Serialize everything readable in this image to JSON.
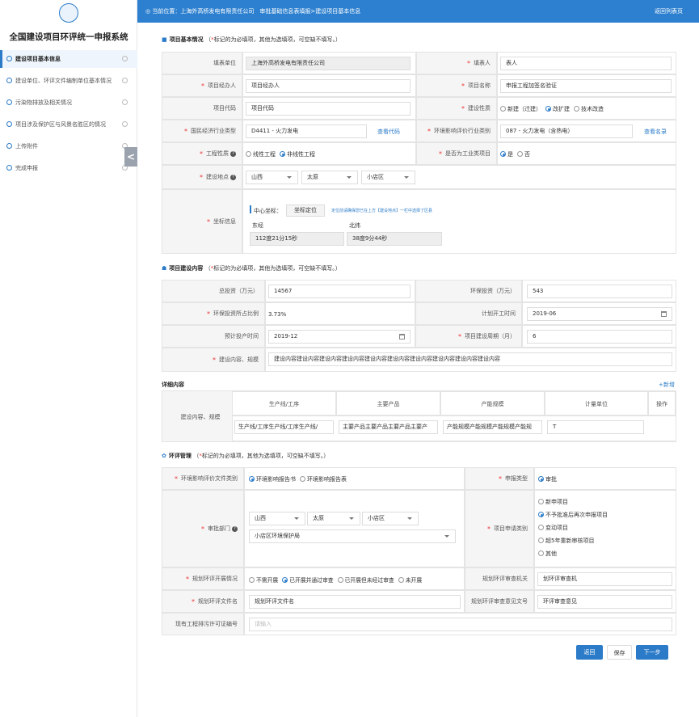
{
  "sidebar": {
    "title": "全国建设项目环评统一申报系统",
    "items": [
      {
        "label": "建设项目基本信息"
      },
      {
        "label": "建设单位、环评文件编制单位基本情况"
      },
      {
        "label": "污染物排放及相关情况"
      },
      {
        "label": "项目涉及保护区与风景名胜区的情况"
      },
      {
        "label": "上传附件"
      },
      {
        "label": "完成申报"
      }
    ],
    "collapse_glyph": "<"
  },
  "breadcrumb": {
    "text": "当前位置：上海外高桥发电有限责任公司　审批基础信息表填报>建设项目基本信息",
    "back": "返回列表页"
  },
  "basic": {
    "title": "项目基本情况",
    "hint_pre": "（",
    "hint_req": "*",
    "hint_post": "标记的为必填项，其他为选填项，可空缺不填写。）",
    "labels": {
      "fill_unit": "填表单位",
      "filler": "填表人",
      "manager": "项目经办人",
      "name": "项目名称",
      "code": "项目代码",
      "nature": "建设性质",
      "industry": "国民经济行业类型",
      "eia_cat": "环境影响评价行业类别",
      "eng_nature": "工程性质",
      "industrial": "是否为工业类项目",
      "location": "建设地点",
      "coord": "坐标信息"
    },
    "fill_unit": "上海外高桥发电有限责任公司",
    "filler": "表人",
    "manager": "项目经办人",
    "name": "申报工程加签名验证",
    "code": "项目代码",
    "nature_opts": [
      "新建（迁建）",
      "改扩建",
      "技术改造"
    ],
    "industry": "D4411 - 火力发电",
    "industry_link": "查看代码",
    "eia_cat": "087 - 火力发电（含热电）",
    "eia_link": "查看名录",
    "eng_opts": [
      "线性工程",
      "非线性工程"
    ],
    "ind_opts": [
      "是",
      "否"
    ],
    "province": "山西",
    "city": "太原",
    "district": "小店区",
    "center_label": "中心坐标：",
    "locate_btn": "坐标定位",
    "locate_hint": "定位前请确保您已在上方【建设地点】一栏中选择了区县",
    "lng_label": "东经",
    "lng": "112度21分15秒",
    "lat_label": "北纬",
    "lat": "38度9分44秒"
  },
  "content": {
    "title": "项目建设内容",
    "hint_pre": "（",
    "hint_req": "*",
    "hint_post": "标记的为必填项，其他为选填项，可空缺不填写。）",
    "labels": {
      "total": "总投资（万元）",
      "env": "环保投资（万元）",
      "ratio": "环保投资所占比例",
      "start": "计划开工时间",
      "prod": "预计投产时间",
      "period": "项目建设周期（月）",
      "scale": "建设内容、规模"
    },
    "total": "14567",
    "env": "543",
    "ratio": "3.73%",
    "start": "2019-06",
    "prod": "2019-12",
    "period": "6",
    "scale": "建设内容建设内容建设内容建设内容建设内容建设内容建设内容建设内容建设内容建设内容"
  },
  "detail": {
    "title": "详细内容",
    "add": "+新增",
    "row_label": "建设内容、规模",
    "headers": [
      "生产线/工序",
      "主要产品",
      "产能规模",
      "计量单位",
      "操作"
    ],
    "row": [
      "生产线/工序生产线/工序生产线/",
      "主要产品主要产品主要产品主要产",
      "产能规模产能规模产能规模产能规",
      "T"
    ]
  },
  "eia": {
    "title": "环评管理",
    "hint_pre": "（",
    "hint_req": "*",
    "hint_post": "标记的为必填项，其他为选填项，可空缺不填写。）",
    "labels": {
      "doc_type": "环境影响评价文件类别",
      "apply_type": "申报类型",
      "dept": "审批部门",
      "app_cat": "项目申请类别",
      "plan_status": "规划环评开展情况",
      "plan_org": "规划环评审查机关",
      "plan_file": "规划环评文件名",
      "plan_doc": "规划环评审查意见文号",
      "permit": "现有工程排污许可证编号"
    },
    "doc_opts": [
      "环境影响报告书",
      "环境影响报告表"
    ],
    "apply_opts": [
      "审批"
    ],
    "province": "山西",
    "city": "太原",
    "district": "小店区",
    "dept": "小店区环境保护局",
    "app_opts": [
      "新申项目",
      "不予批准后再次申报项目",
      "变动项目",
      "超5年重新审核项目",
      "其他"
    ],
    "plan_opts": [
      "不需开展",
      "已开展并通过审查",
      "已开展但未经过审查",
      "未开展"
    ],
    "plan_org": "划环评审查机",
    "plan_file": "规划环评文件名",
    "plan_doc": "环评审查意见",
    "permit_ph": "请输入"
  },
  "footer": {
    "back": "返回",
    "save": "保存",
    "next": "下一步"
  },
  "colors": {
    "accent": "#2d80cf",
    "required": "#e33333"
  }
}
